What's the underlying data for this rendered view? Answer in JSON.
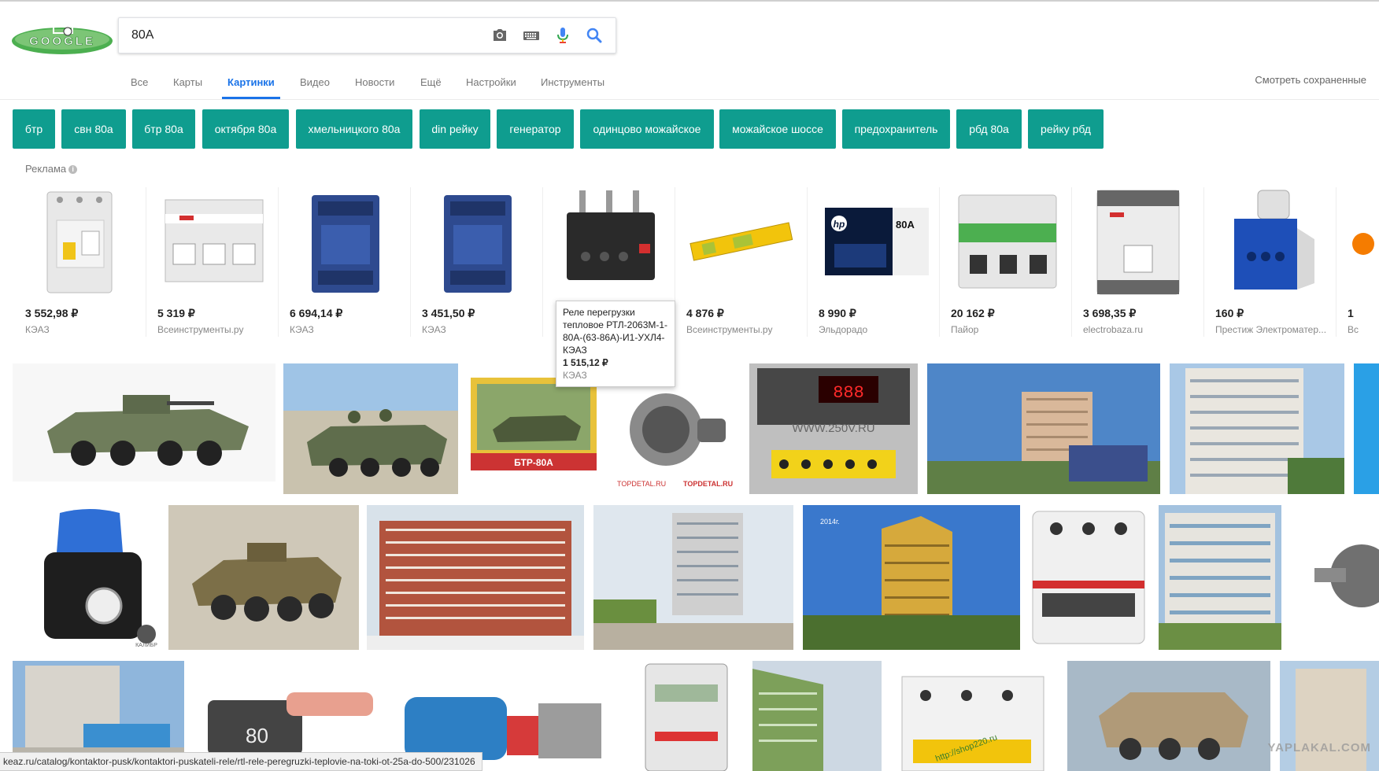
{
  "logo": {
    "text": "GOOGLE"
  },
  "search": {
    "value": "80A",
    "placeholder": ""
  },
  "icons": {
    "camera": "camera-icon",
    "keyboard": "keyboard-icon",
    "mic": "microphone-icon",
    "search": "search-icon"
  },
  "tabs": [
    {
      "label": "Все"
    },
    {
      "label": "Карты"
    },
    {
      "label": "Картинки",
      "active": true
    },
    {
      "label": "Видео"
    },
    {
      "label": "Новости"
    },
    {
      "label": "Ещё"
    },
    {
      "label": "Настройки"
    },
    {
      "label": "Инструменты"
    }
  ],
  "saved_link": "Смотреть сохраненные",
  "chips": [
    "бтр",
    "свн 80а",
    "бтр 80а",
    "октября 80а",
    "хмельницкого 80а",
    "din рейку",
    "генератор",
    "одинцово можайское",
    "можайское шоссе",
    "предохранитель",
    "рбд 80а",
    "рейку рбд"
  ],
  "ads_label": "Реклама",
  "ads": [
    {
      "price": "3 552,98 ₽",
      "store": "КЭАЗ"
    },
    {
      "price": "5 319 ₽",
      "store": "Всеинструменты.ру"
    },
    {
      "price": "6 694,14 ₽",
      "store": "КЭАЗ"
    },
    {
      "price": "3 451,50 ₽",
      "store": "КЭАЗ"
    },
    {
      "price": "",
      "store": ""
    },
    {
      "price": "4 876 ₽",
      "store": "Всеинструменты.ру"
    },
    {
      "price": "8 990 ₽",
      "store": "Эльдорадо"
    },
    {
      "price": "20 162 ₽",
      "store": "Пайор"
    },
    {
      "price": "3 698,35 ₽",
      "store": "electrobaza.ru"
    },
    {
      "price": "160 ₽",
      "store": "Престиж Электроматер..."
    },
    {
      "price": "1",
      "store": "Вс"
    }
  ],
  "tooltip": {
    "title": "Реле перегрузки тепловое РТЛ-2063М-1-80А-(63-86А)-И1-УХЛ4-КЭАЗ",
    "price": "1 515,12 ₽",
    "store": "КЭАЗ"
  },
  "image_texts": {
    "domovoy": "WWW.250V.RU",
    "topdetal": "TOPDETAL.RU",
    "btr_box": "БТР-80А",
    "kalibr": "КАЛИБР",
    "year": "2014г.",
    "fuse": "80",
    "site": "http://shop220.ru"
  },
  "status_url": "keaz.ru/catalog/kontaktor-pusk/kontaktori-puskateli-rele/rtl-rele-peregruzki-teplovie-na-toki-ot-25a-do-500/231026",
  "watermark": "YAPLAKAL.COM"
}
